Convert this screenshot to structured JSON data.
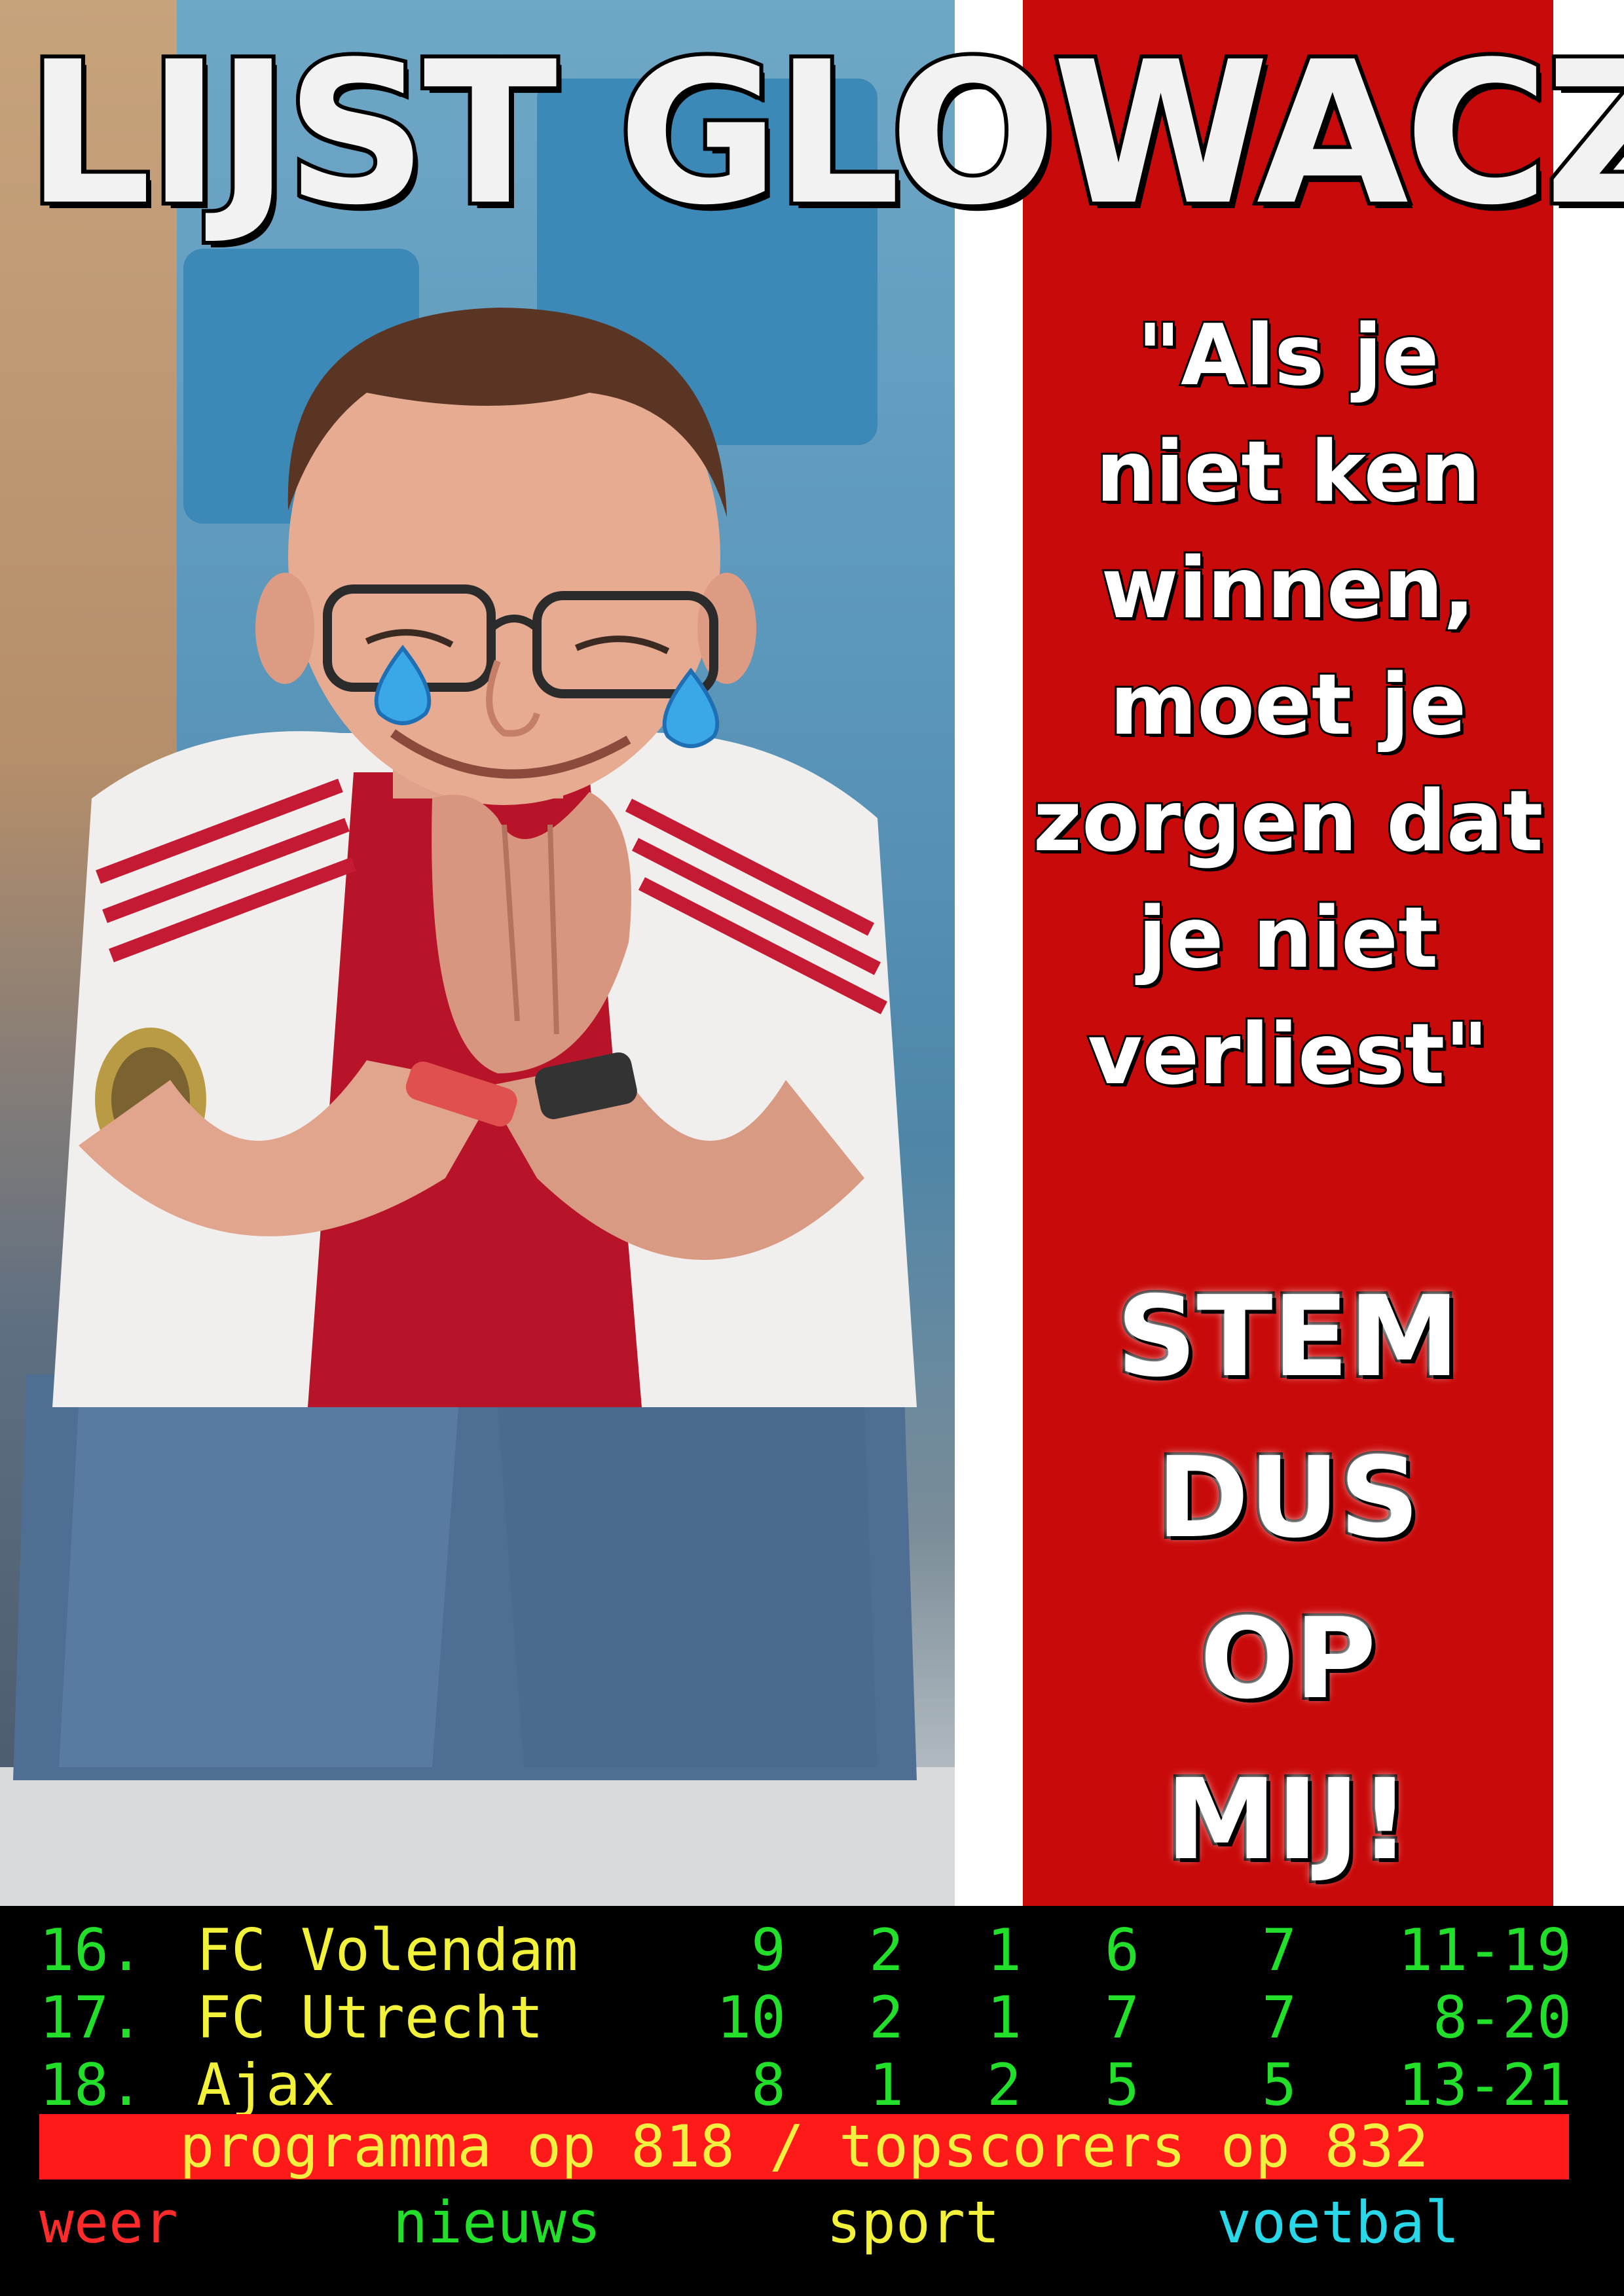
{
  "poster": {
    "headline": "LIJST GLOWACZ",
    "quote_lines": [
      "\"Als je",
      "niet ken",
      "winnen,",
      "moet je",
      "zorgen dat",
      "je niet",
      "verliest\""
    ],
    "cta_lines": [
      "STEM",
      "DUS",
      "OP",
      "MIJ!"
    ],
    "colors": {
      "stripe_red": "#c90a0a",
      "stripe_white": "#ffffff"
    }
  },
  "teletext": {
    "standings": [
      {
        "pos": "16.",
        "team": "FC Volendam",
        "c1": "9",
        "c2": "2",
        "c3": "1",
        "c4": "6",
        "c5": "7",
        "goals": "11-19"
      },
      {
        "pos": "17.",
        "team": "FC Utrecht",
        "c1": "10",
        "c2": "2",
        "c3": "1",
        "c4": "7",
        "c5": "7",
        "goals": "8-20"
      },
      {
        "pos": "18.",
        "team": "Ajax",
        "c1": "8",
        "c2": "1",
        "c3": "2",
        "c4": "5",
        "c5": "5",
        "goals": "13-21"
      }
    ],
    "banner": "programma op 818 / topscorers op 832",
    "nav": {
      "red": "weer",
      "green": "nieuws",
      "yellow": "sport",
      "cyan": "voetbal"
    }
  }
}
